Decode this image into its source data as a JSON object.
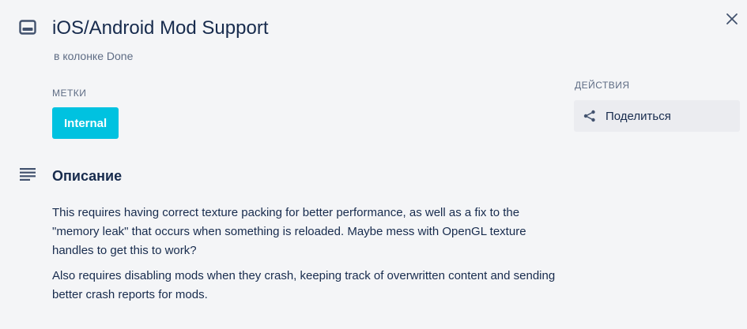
{
  "card": {
    "title": "iOS/Android Mod Support",
    "list_location": "в колонке Done",
    "icon": "card-icon"
  },
  "dialog": {
    "close_icon": "close-icon"
  },
  "labels": {
    "heading": "МЕТКИ",
    "items": [
      {
        "text": "Internal",
        "color": "#00c2e0"
      }
    ]
  },
  "description": {
    "icon": "description-icon",
    "heading": "Описание",
    "paragraphs": [
      "This requires having correct texture packing for better performance, as well as a fix to the \"memory leak\" that occurs when something is reloaded. Maybe mess with OpenGL texture handles to get this to work?",
      "Also requires disabling mods when they crash, keeping track of overwritten content and sending better crash reports for mods."
    ]
  },
  "actions": {
    "heading": "ДЕЙСТВИЯ",
    "share_label": "Поделиться",
    "share_icon": "share-icon"
  },
  "colors": {
    "background": "#f4f5f7",
    "text": "#172b4d",
    "muted": "#5e6c84",
    "button_bg": "#ebecf0"
  }
}
